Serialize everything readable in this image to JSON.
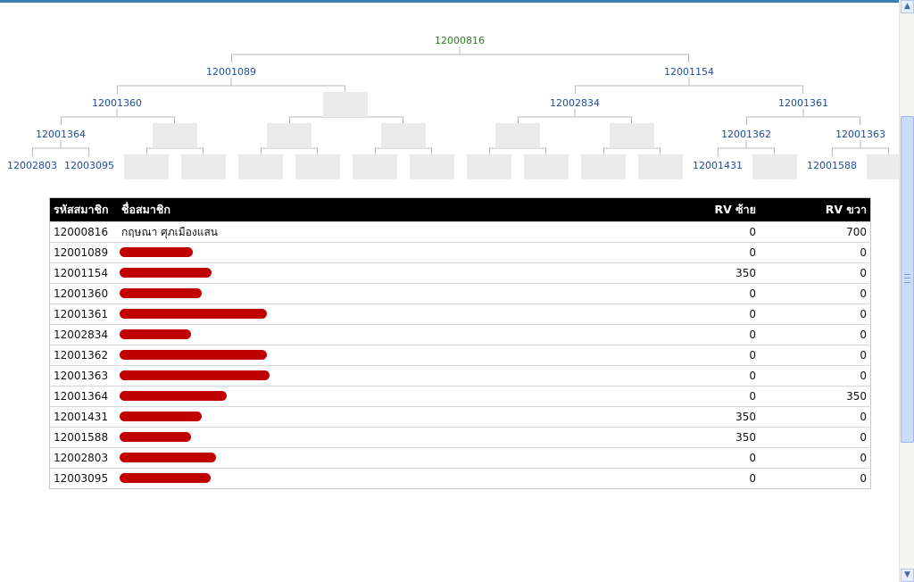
{
  "tree": {
    "root": "12000816",
    "l1_left": "12001089",
    "l1_right": "12001154",
    "l2_a": "12001360",
    "l2_c": "12002834",
    "l2_d": "12001361",
    "l3_a": "12001364",
    "l3_g": "12001362",
    "l3_h": "12001363",
    "l4_a": "12002803",
    "l4_b": "12003095",
    "l4_m": "12001431",
    "l4_o": "12001588"
  },
  "table": {
    "headers": {
      "code": "รหัสสมาชิก",
      "name": "ชื่อสมาชิก",
      "rv_left": "RV ซ้าย",
      "rv_right": "RV ขวา"
    },
    "rows": [
      {
        "code": "12000816",
        "name": "กฤษณา ศุภเมืองแสน",
        "rv_left": "0",
        "rv_right": "700"
      },
      {
        "code": "12001089",
        "name": "",
        "rv_left": "0",
        "rv_right": "0"
      },
      {
        "code": "12001154",
        "name": "",
        "rv_left": "350",
        "rv_right": "0"
      },
      {
        "code": "12001360",
        "name": "",
        "rv_left": "0",
        "rv_right": "0"
      },
      {
        "code": "12001361",
        "name": "",
        "rv_left": "0",
        "rv_right": "0"
      },
      {
        "code": "12002834",
        "name": "",
        "rv_left": "0",
        "rv_right": "0"
      },
      {
        "code": "12001362",
        "name": "",
        "rv_left": "0",
        "rv_right": "0"
      },
      {
        "code": "12001363",
        "name": "",
        "rv_left": "0",
        "rv_right": "0"
      },
      {
        "code": "12001364",
        "name": "",
        "rv_left": "0",
        "rv_right": "350"
      },
      {
        "code": "12001431",
        "name": "",
        "rv_left": "350",
        "rv_right": "0"
      },
      {
        "code": "12001588",
        "name": "",
        "rv_left": "350",
        "rv_right": "0"
      },
      {
        "code": "12002803",
        "name": "",
        "rv_left": "0",
        "rv_right": "0"
      },
      {
        "code": "12003095",
        "name": "",
        "rv_left": "0",
        "rv_right": "0"
      }
    ]
  },
  "colors": {
    "root_text": "#2e7d1f",
    "node_text": "#1f4fa0",
    "header_bg": "#000000",
    "redaction": "#c00000",
    "empty_slot": "#ebebeb"
  },
  "icons": {
    "scroll_up": "triangle-up-icon",
    "scroll_down": "triangle-down-icon"
  }
}
